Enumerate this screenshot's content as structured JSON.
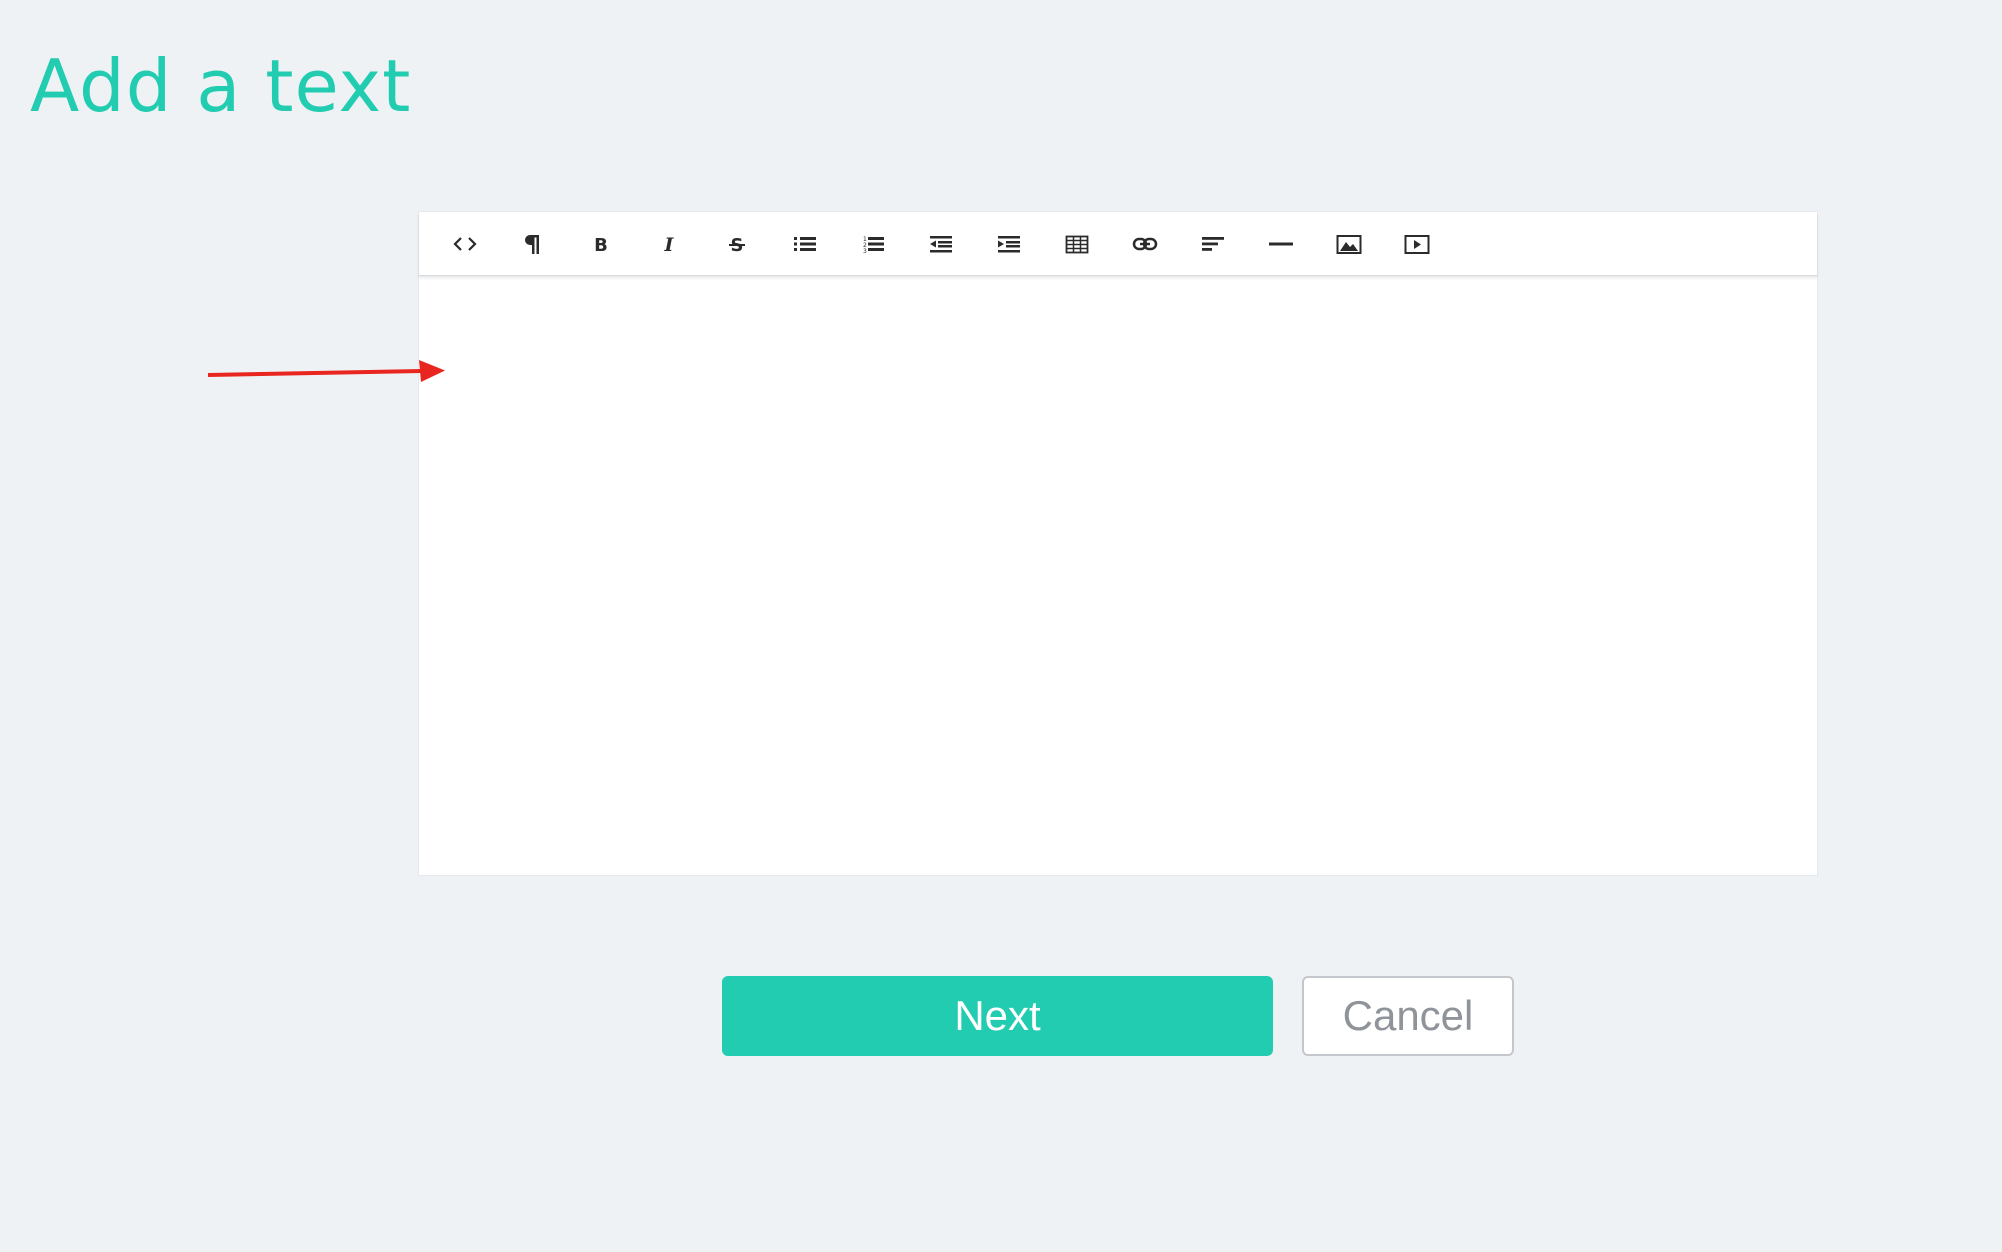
{
  "page": {
    "title": "Add a text"
  },
  "editor": {
    "toolbar_buttons": [
      {
        "name": "html-icon",
        "tooltip": "HTML"
      },
      {
        "name": "paragraph-icon",
        "tooltip": "Formatting"
      },
      {
        "name": "bold-icon",
        "tooltip": "Bold"
      },
      {
        "name": "italic-icon",
        "tooltip": "Italic"
      },
      {
        "name": "strikethrough-icon",
        "tooltip": "Deleted"
      },
      {
        "name": "unordered-list-icon",
        "tooltip": "Unordered List"
      },
      {
        "name": "ordered-list-icon",
        "tooltip": "Ordered List"
      },
      {
        "name": "outdent-icon",
        "tooltip": "Outdent"
      },
      {
        "name": "indent-icon",
        "tooltip": "Indent"
      },
      {
        "name": "table-icon",
        "tooltip": "Table"
      },
      {
        "name": "link-icon",
        "tooltip": "Link"
      },
      {
        "name": "align-icon",
        "tooltip": "Alignment"
      },
      {
        "name": "horizontal-rule-icon",
        "tooltip": "Insert Horizontal Rule"
      },
      {
        "name": "image-icon",
        "tooltip": "Image"
      },
      {
        "name": "video-icon",
        "tooltip": "Video"
      }
    ],
    "content": ""
  },
  "annotation": {
    "arrow_color": "#e8251e"
  },
  "actions": {
    "next_label": "Next",
    "cancel_label": "Cancel"
  },
  "colors": {
    "accent": "#22ccb0",
    "background": "#eff2f5"
  }
}
